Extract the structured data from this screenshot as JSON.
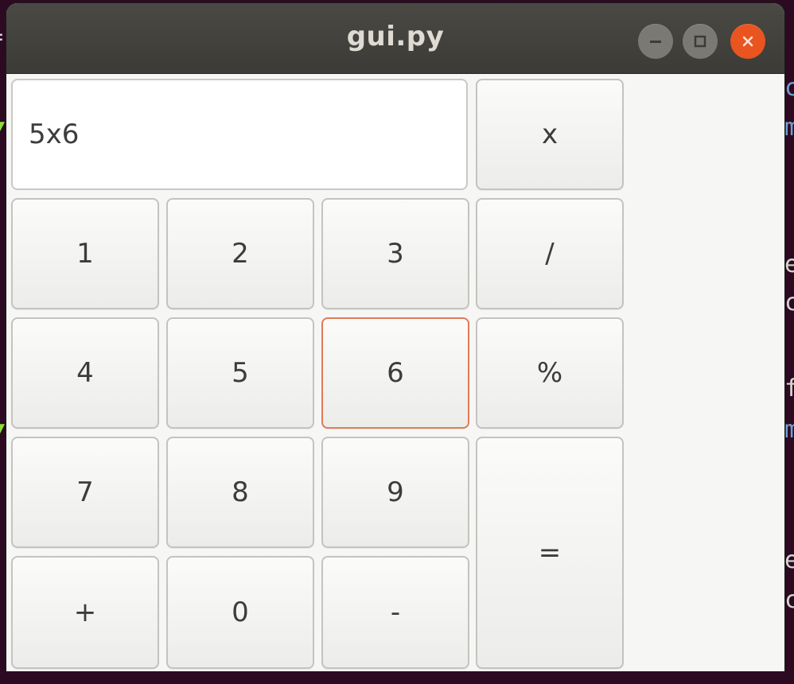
{
  "window": {
    "title": "gui.py",
    "controls": {
      "minimize_icon": "minimize-icon",
      "maximize_icon": "maximize-icon",
      "close_icon": "close-icon"
    }
  },
  "display": {
    "value": "5x6"
  },
  "keys": {
    "times": "x",
    "k1": "1",
    "k2": "2",
    "k3": "3",
    "divide": "/",
    "k4": "4",
    "k5": "5",
    "k6": "6",
    "percent": "%",
    "k7": "7",
    "k8": "8",
    "k9": "9",
    "equals": "=",
    "plus": "+",
    "k0": "0",
    "minus": "-"
  },
  "colors": {
    "titlebar": "#3c3b37",
    "close_button": "#e9541f",
    "focus_border": "#e07a55",
    "window_bg": "#f6f6f5"
  }
}
